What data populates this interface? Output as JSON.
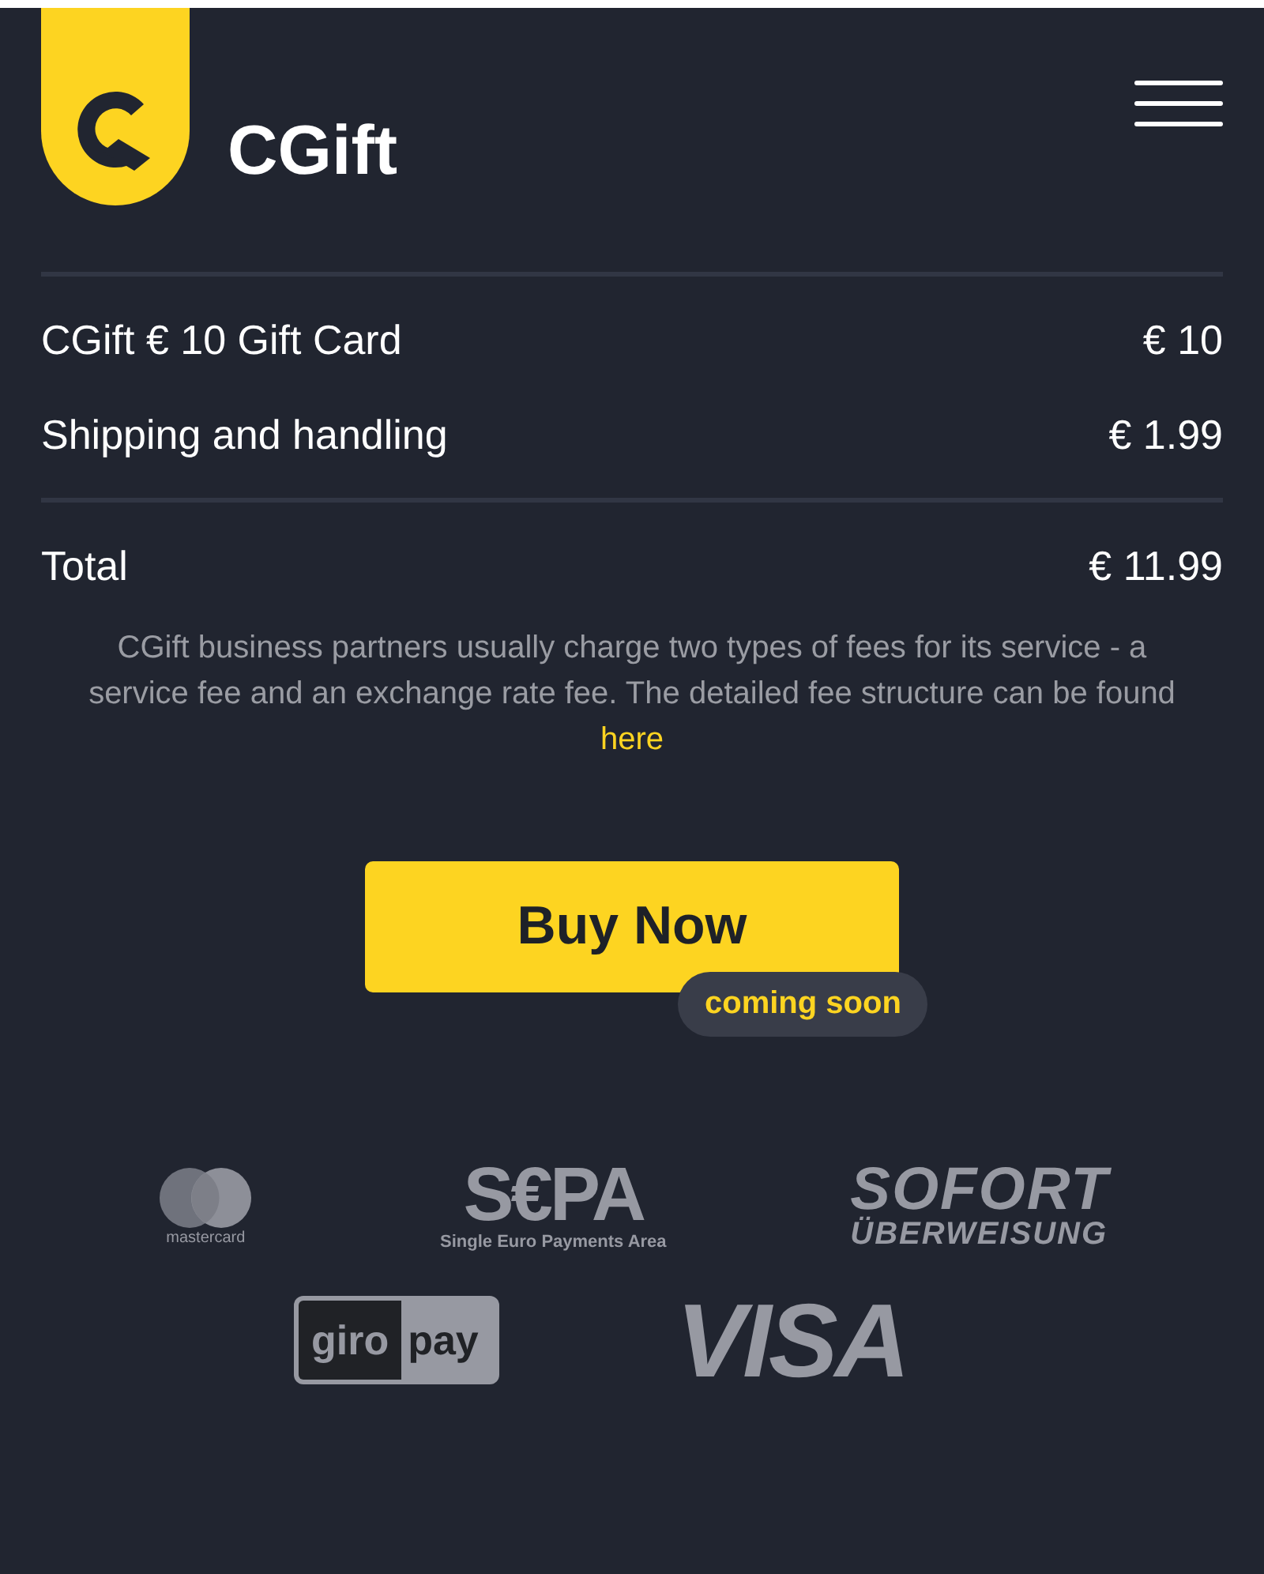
{
  "brand": {
    "name": "CGift"
  },
  "order": {
    "items": [
      {
        "label": "CGift € 10 Gift Card",
        "price": "€ 10"
      },
      {
        "label": "Shipping and handling",
        "price": "€ 1.99"
      }
    ],
    "total": {
      "label": "Total",
      "price": "€ 11.99"
    }
  },
  "note": {
    "text": "CGift business partners usually charge two types of fees for its service - a service fee and an exchange rate fee. The detailed fee structure can be found",
    "link": "here"
  },
  "buy_button": {
    "label": "Buy Now",
    "badge": "coming soon"
  },
  "payment_logos": [
    {
      "kind": "mastercard",
      "lines": [
        "mastercard"
      ]
    },
    {
      "kind": "sepa",
      "lines": [
        "S€PA",
        "Single Euro Payments Area"
      ]
    },
    {
      "kind": "sofort",
      "lines": [
        "SOFORT",
        "ÜBERWEISUNG"
      ]
    },
    {
      "kind": "giropay",
      "lines": [
        "giro",
        "pay"
      ]
    },
    {
      "kind": "visa",
      "lines": [
        "VISA"
      ]
    }
  ]
}
